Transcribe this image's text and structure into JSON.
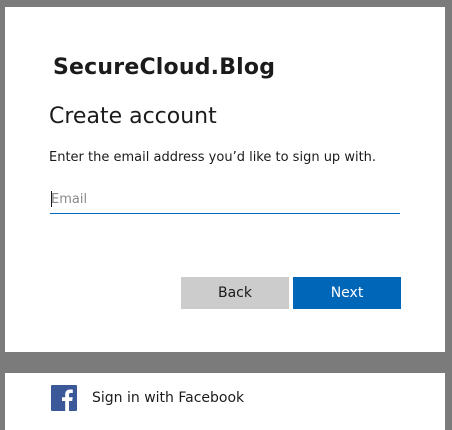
{
  "brand": {
    "logo_text": "SecureCloud.Blog"
  },
  "form": {
    "title": "Create account",
    "description": "Enter the email address you’d like to sign up with.",
    "email_value": "",
    "email_placeholder": "Email"
  },
  "buttons": {
    "back_label": "Back",
    "next_label": "Next"
  },
  "social": {
    "icon": "facebook-icon",
    "label": "Sign in with Facebook"
  },
  "colors": {
    "accent": "#0067b8",
    "back_button": "#cccccc",
    "facebook": "#3b5998",
    "page_background": "#7b7b7b"
  }
}
